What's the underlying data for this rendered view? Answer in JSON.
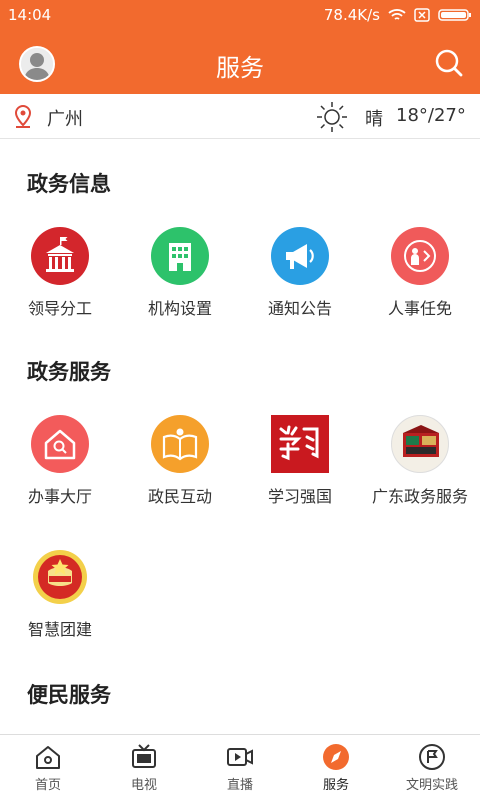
{
  "status_bar": {
    "time": "14:04",
    "network_speed": "78.4K/s"
  },
  "app_bar": {
    "title": "服务"
  },
  "location_bar": {
    "city": "广州",
    "weather": "晴",
    "temperature": "18°/27°"
  },
  "sections": {
    "gov_info": {
      "title": "政务信息",
      "items": [
        {
          "label": "领导分工",
          "icon": "government-building-icon",
          "color": "#d3262c"
        },
        {
          "label": "机构设置",
          "icon": "office-building-icon",
          "color": "#2dc26b"
        },
        {
          "label": "通知公告",
          "icon": "megaphone-icon",
          "color": "#2a9fe3"
        },
        {
          "label": "人事任免",
          "icon": "person-appointment-icon",
          "color": "#f05a5a"
        }
      ]
    },
    "gov_service": {
      "title": "政务服务",
      "items": [
        {
          "label": "办事大厅",
          "icon": "service-hall-icon",
          "color": "#f35b5b"
        },
        {
          "label": "政民互动",
          "icon": "interaction-book-icon",
          "color": "#f5a02b"
        },
        {
          "label": "学习强国",
          "icon": "xuexi-qiangguo-logo",
          "color": "#c9191f"
        },
        {
          "label": "广东政务服务",
          "icon": "guangdong-gov-service-logo",
          "color": "#b82020"
        },
        {
          "label": "智慧团建",
          "icon": "youth-league-emblem",
          "color": "#d42a24"
        }
      ]
    },
    "convenience": {
      "title": "便民服务"
    }
  },
  "tab_bar": {
    "items": [
      {
        "label": "首页",
        "icon": "home-icon"
      },
      {
        "label": "电视",
        "icon": "tv-icon"
      },
      {
        "label": "直播",
        "icon": "live-video-icon"
      },
      {
        "label": "服务",
        "icon": "compass-icon",
        "active": true,
        "color": "#f26a2e"
      },
      {
        "label": "文明实践",
        "icon": "flag-badge-icon"
      }
    ]
  },
  "colors": {
    "brand": "#f26a2e"
  }
}
